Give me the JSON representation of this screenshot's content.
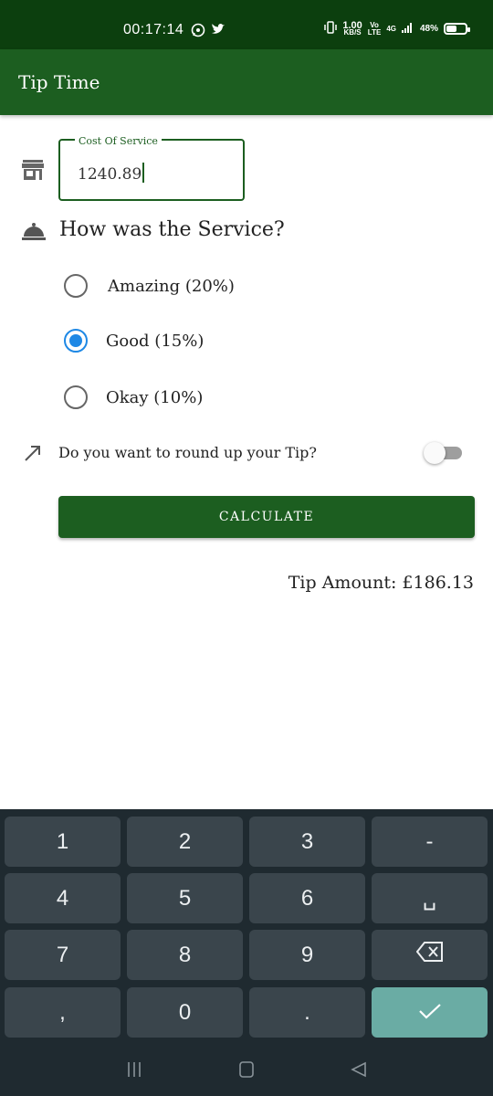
{
  "status_bar": {
    "time": "00:17:14",
    "net_speed_value": "1.00",
    "net_speed_unit": "KB/S",
    "volte_top": "Vo",
    "volte_bottom": "LTE",
    "signal": "4G",
    "battery": "48%"
  },
  "app_bar": {
    "title": "Tip Time"
  },
  "cost_field": {
    "label": "Cost Of Service",
    "value": "1240.89"
  },
  "service": {
    "question": "How was the Service?",
    "options": [
      {
        "label": "Amazing (20%)",
        "selected": false
      },
      {
        "label": "Good (15%)",
        "selected": true
      },
      {
        "label": "Okay (10%)",
        "selected": false
      }
    ]
  },
  "round_up": {
    "label": "Do you want to round up your Tip?",
    "on": false
  },
  "calculate": {
    "label": "CALCULATE"
  },
  "result": {
    "text": "Tip Amount: £186.13"
  },
  "keyboard": {
    "keys": [
      "1",
      "2",
      "3",
      "-",
      "4",
      "5",
      "6",
      "␣",
      "7",
      "8",
      "9",
      "⌫",
      ",",
      "0",
      ".",
      "✓"
    ]
  },
  "colors": {
    "status_bar": "#0c3f0e",
    "app_bar": "#1c5e20",
    "radio_selected": "#1e88e5",
    "keyboard_bg": "#1f2a30",
    "key_bg": "#3a454c",
    "done_key": "#6aaca4"
  },
  "icons": [
    "whatsapp-icon",
    "twitter-icon",
    "vibrate-icon",
    "signal-icon",
    "battery-icon",
    "store-icon",
    "room-service-icon",
    "trending-up-icon",
    "backspace-icon",
    "check-icon",
    "recent-apps-icon",
    "home-icon",
    "back-icon"
  ]
}
